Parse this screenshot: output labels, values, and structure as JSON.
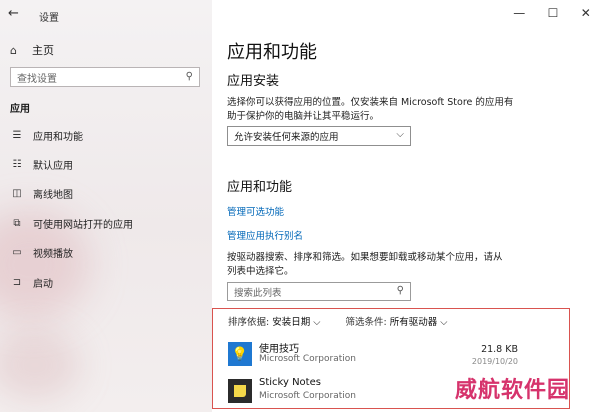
{
  "window": {
    "back_icon": "back-arrow-icon",
    "title": "设置",
    "controls": [
      "—",
      "☐",
      "✕"
    ]
  },
  "sidebar": {
    "home_label": "主页",
    "search_placeholder": "查找设置",
    "section": "应用",
    "items": [
      {
        "label": "应用和功能",
        "icon": "apps-list-icon"
      },
      {
        "label": "默认应用",
        "icon": "default-apps-icon"
      },
      {
        "label": "离线地图",
        "icon": "map-icon"
      },
      {
        "label": "可使用网站打开的应用",
        "icon": "web-apps-icon"
      },
      {
        "label": "视频播放",
        "icon": "video-icon"
      },
      {
        "label": "启动",
        "icon": "startup-icon"
      }
    ]
  },
  "main": {
    "title": "应用和功能",
    "install": {
      "heading": "应用安装",
      "desc_line1": "选择你可以获得应用的位置。仅安装来自 Microsoft Store 的应用有",
      "desc_line2": "助于保护你的电脑并让其平稳运行。",
      "dropdown_value": "允许安装任何来源的应用"
    },
    "apps": {
      "heading": "应用和功能",
      "link_optional": "管理可选功能",
      "link_alias": "管理应用执行别名",
      "desc_line1": "按驱动器搜索、排序和筛选。如果想要卸载或移动某个应用，请从",
      "desc_line2": "列表中选择它。",
      "search_placeholder": "搜索此列表",
      "sort_label": "排序依据:",
      "sort_value": "安装日期",
      "filter_label": "筛选条件:",
      "filter_value": "所有驱动器",
      "list": [
        {
          "name": "使用技巧",
          "publisher": "Microsoft Corporation",
          "size": "21.8 KB",
          "date": "2019/10/20",
          "icon": "lightbulb-icon",
          "color": "#1f78d1"
        },
        {
          "name": "Sticky Notes",
          "publisher": "Microsoft Corporation",
          "size": "",
          "date": "",
          "icon": "sticky-note-icon",
          "color": "#2b2b2b"
        }
      ]
    }
  },
  "watermark": "威航软件园"
}
